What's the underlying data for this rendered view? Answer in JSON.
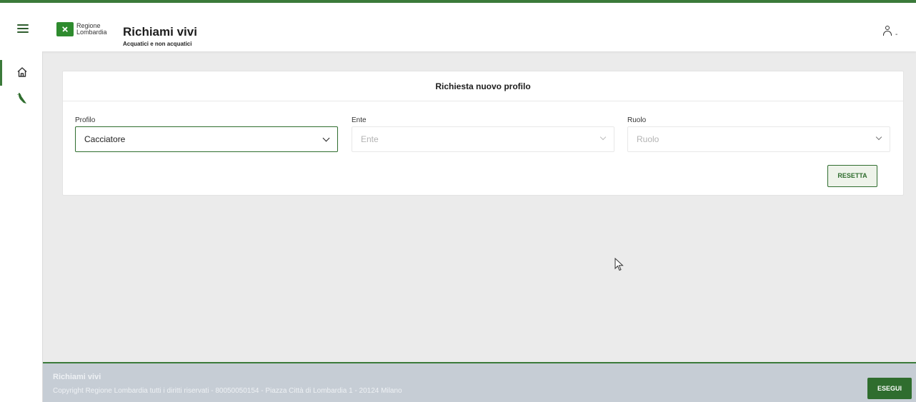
{
  "header": {
    "logo_line1": "Regione",
    "logo_line2": "Lombardia",
    "title": "Richiami vivi",
    "subtitle": "Acquatici e non acquatici",
    "user_suffix": "-"
  },
  "sidebar": {
    "items": [
      {
        "icon": "home-icon",
        "active": true
      },
      {
        "icon": "bird-icon",
        "active": false
      }
    ]
  },
  "form": {
    "title": "Richiesta nuovo profilo",
    "fields": [
      {
        "label": "Profilo",
        "value": "Cacciatore",
        "disabled": false
      },
      {
        "label": "Ente",
        "placeholder": "Ente",
        "disabled": true
      },
      {
        "label": "Ruolo",
        "placeholder": "Ruolo",
        "disabled": true
      }
    ],
    "reset_label": "RESETTA"
  },
  "footer": {
    "title": "Richiami vivi",
    "copyright": "Copyright Regione Lombardia tutti i diritti riservati - 80050050154 - Piazza Città di Lombardia 1 - 20124 Milano",
    "execute_label": "ESEGUI"
  },
  "colors": {
    "accent": "#3b7a3a",
    "button": "#2f6d2e",
    "footer_bg": "#c6cdd5",
    "page_bg": "#ebebeb"
  }
}
